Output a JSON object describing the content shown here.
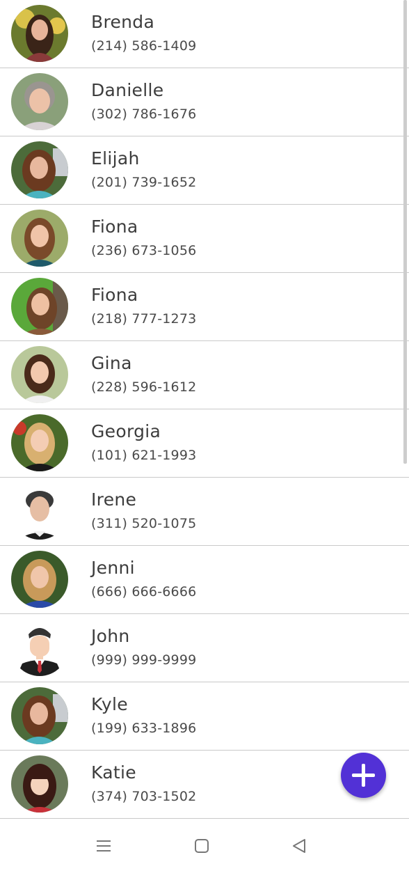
{
  "contacts": [
    {
      "name": "Brenda",
      "phone": "(214) 586-1409",
      "avatar": "woman-dark-hair-photo"
    },
    {
      "name": "Danielle",
      "phone": "(302) 786-1676",
      "avatar": "older-woman-photo"
    },
    {
      "name": "Elijah",
      "phone": "(201) 739-1652",
      "avatar": "woman-curly-hair-photo"
    },
    {
      "name": "Fiona",
      "phone": "(236) 673-1056",
      "avatar": "woman-brown-hair-photo"
    },
    {
      "name": "Fiona",
      "phone": "(218) 777-1273",
      "avatar": "woman-outdoor-photo"
    },
    {
      "name": "Gina",
      "phone": "(228) 596-1612",
      "avatar": "woman-smiling-photo"
    },
    {
      "name": "Georgia",
      "phone": "(101) 621-1993",
      "avatar": "woman-blonde-photo"
    },
    {
      "name": "Irene",
      "phone": "(311) 520-1075",
      "avatar": "man-portrait-photo"
    },
    {
      "name": "Jenni",
      "phone": "(666) 666-6666",
      "avatar": "woman-auburn-hair-photo"
    },
    {
      "name": "John",
      "phone": "(999) 999-9999",
      "avatar": "default-male-avatar"
    },
    {
      "name": "Kyle",
      "phone": "(199) 633-1896",
      "avatar": "woman-curly-hair-photo"
    },
    {
      "name": "Katie",
      "phone": "(374) 703-1502",
      "avatar": "woman-bangs-photo"
    }
  ],
  "fab": {
    "icon": "plus-icon",
    "color": "#5231d6"
  },
  "navbar": {
    "icons": [
      "menu-icon",
      "home-square-icon",
      "back-triangle-icon"
    ]
  },
  "colors": {
    "name_text": "#3d3d3d",
    "phone_text": "#4a4a4a",
    "divider": "#c9c9c9"
  }
}
